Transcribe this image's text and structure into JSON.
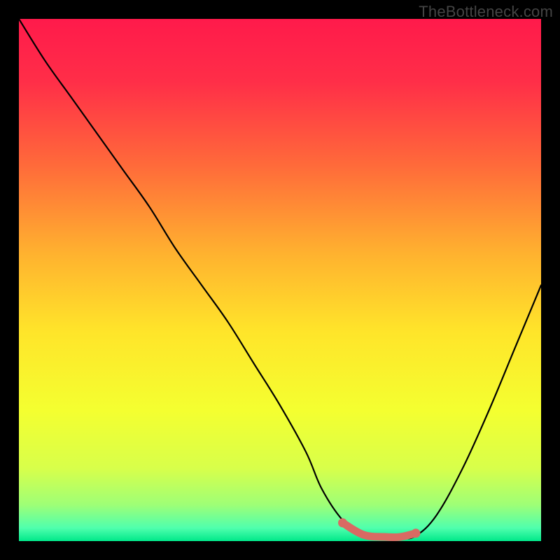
{
  "watermark": "TheBottleneck.com",
  "chart_data": {
    "type": "line",
    "title": "",
    "xlabel": "",
    "ylabel": "",
    "xlim": [
      0,
      100
    ],
    "ylim": [
      0,
      100
    ],
    "series": [
      {
        "name": "bottleneck-curve",
        "x": [
          0,
          5,
          10,
          15,
          20,
          25,
          30,
          35,
          40,
          45,
          50,
          55,
          58,
          62,
          66,
          70,
          73,
          76,
          80,
          85,
          90,
          95,
          100
        ],
        "values": [
          100,
          92,
          85,
          78,
          71,
          64,
          56,
          49,
          42,
          34,
          26,
          17,
          10,
          4,
          1,
          0.5,
          0.5,
          1,
          5,
          14,
          25,
          37,
          49
        ]
      },
      {
        "name": "optimal-range-marker",
        "x": [
          62,
          66,
          70,
          73,
          76
        ],
        "values": [
          3.5,
          1.2,
          0.8,
          0.8,
          1.5
        ]
      }
    ],
    "gradient_stops": [
      {
        "offset": 0,
        "color": "#ff1a4b"
      },
      {
        "offset": 0.12,
        "color": "#ff2e48"
      },
      {
        "offset": 0.28,
        "color": "#ff6a3a"
      },
      {
        "offset": 0.45,
        "color": "#ffb22f"
      },
      {
        "offset": 0.6,
        "color": "#ffe52a"
      },
      {
        "offset": 0.75,
        "color": "#f4ff30"
      },
      {
        "offset": 0.86,
        "color": "#d8ff4a"
      },
      {
        "offset": 0.93,
        "color": "#9fff76"
      },
      {
        "offset": 0.975,
        "color": "#4fffad"
      },
      {
        "offset": 1.0,
        "color": "#00e88a"
      }
    ]
  }
}
